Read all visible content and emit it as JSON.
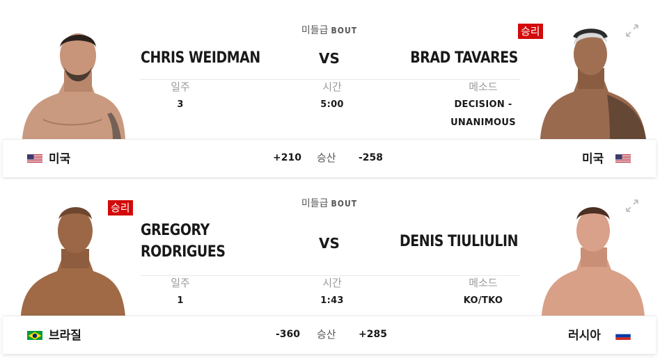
{
  "bouts": [
    {
      "weight_class": "미들급",
      "bout_label": "BOUT",
      "vs_label": "VS",
      "red": {
        "name": "CHRIS WEIDMAN",
        "country": "미국",
        "odds": "+210",
        "winner": false
      },
      "blue": {
        "name": "BRAD TAVARES",
        "country": "미국",
        "odds": "-258",
        "winner": true
      },
      "stats": {
        "round_label": "일주",
        "round_value": "3",
        "time_label": "시간",
        "time_value": "5:00",
        "method_label": "메소드",
        "method_value": "DECISION - UNANIMOUS"
      },
      "odds_label": "승산",
      "winner_badge": "승리"
    },
    {
      "weight_class": "미들급",
      "bout_label": "BOUT",
      "vs_label": "VS",
      "red": {
        "name": "GREGORY RODRIGUES",
        "country": "브라질",
        "odds": "-360",
        "winner": true
      },
      "blue": {
        "name": "DENIS TIULIULIN",
        "country": "러시아",
        "odds": "+285",
        "winner": false
      },
      "stats": {
        "round_label": "일주",
        "round_value": "1",
        "time_label": "시간",
        "time_value": "1:43",
        "method_label": "메소드",
        "method_value": "KO/TKO"
      },
      "odds_label": "승산",
      "winner_badge": "승리"
    }
  ],
  "icons": {
    "expand": "expand-icon"
  },
  "colors": {
    "accent_red": "#d20a0a",
    "text": "#191919",
    "muted": "#9a9a9a"
  }
}
